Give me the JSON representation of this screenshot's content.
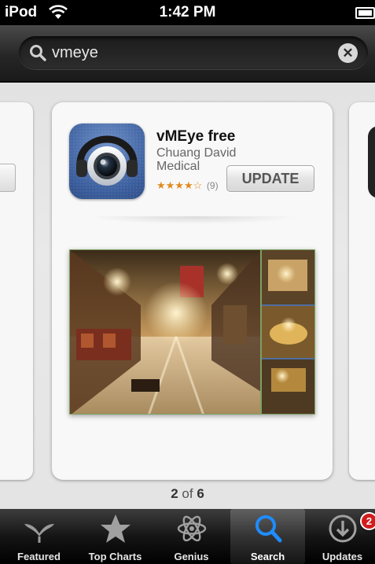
{
  "status_bar": {
    "carrier": "iPod",
    "time": "1:42 PM"
  },
  "search": {
    "query": "vmeye"
  },
  "app_card": {
    "name": "vMEye free",
    "developer": "Chuang David Medical",
    "rating_stars": "★★★★☆",
    "rating_count": "(9)",
    "update_label": "UPDATE"
  },
  "pagination": {
    "current": "2",
    "separator": "of",
    "total": "6"
  },
  "tabs": [
    {
      "label": "Featured",
      "icon": "featured-icon"
    },
    {
      "label": "Top Charts",
      "icon": "star-icon"
    },
    {
      "label": "Genius",
      "icon": "atom-icon"
    },
    {
      "label": "Search",
      "icon": "search-icon"
    },
    {
      "label": "Updates",
      "icon": "download-icon",
      "badge": "2"
    }
  ],
  "colors": {
    "accent_blue": "#1f8cff",
    "badge_red": "#d21c1c",
    "star_orange": "#e08a1e"
  }
}
